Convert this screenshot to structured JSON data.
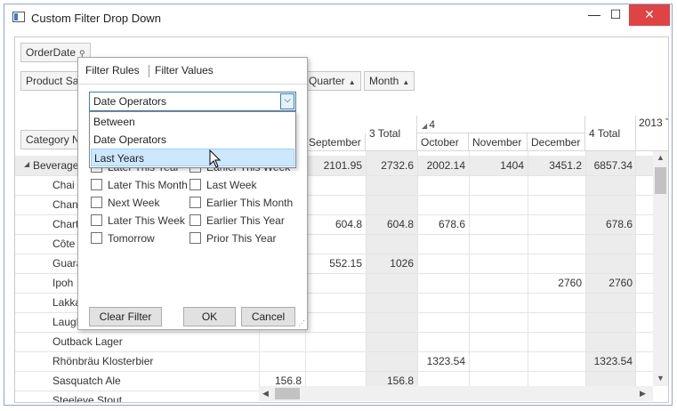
{
  "window": {
    "title": "Custom Filter Drop Down",
    "minimize": "—",
    "maximize": "☐",
    "close": "✕"
  },
  "fields": {
    "filter_area": "OrderDate",
    "row_field_1": "Product Sa",
    "row_field_2": "Category N",
    "column_fields": [
      "Quarter",
      "Month"
    ]
  },
  "column_headers": {
    "september": "September",
    "q3_total": "3 Total",
    "q4": "4",
    "october": "October",
    "november": "November",
    "december": "December",
    "q4_total": "4 Total",
    "year_2013": "2013 T"
  },
  "rows": [
    {
      "label": "Beverage",
      "vals": [
        "2101.95",
        "2732.6",
        "2002.14",
        "1404",
        "3451.2",
        "6857.34"
      ]
    },
    {
      "label": "Chai",
      "vals": [
        "",
        "",
        "",
        "",
        "",
        ""
      ]
    },
    {
      "label": "Chan",
      "vals": [
        "",
        "",
        "",
        "",
        "",
        ""
      ]
    },
    {
      "label": "Chart",
      "vals": [
        "604.8",
        "604.8",
        "678.6",
        "",
        "",
        "678.6"
      ]
    },
    {
      "label": "Côte",
      "vals": [
        "",
        "",
        "",
        "",
        "",
        ""
      ]
    },
    {
      "label": "Guara",
      "vals": [
        "552.15",
        "1026",
        "",
        "",
        "",
        ""
      ]
    },
    {
      "label": "Ipoh",
      "vals": [
        "",
        "",
        "",
        "",
        "2760",
        "2760"
      ]
    },
    {
      "label": "Lakka",
      "vals": [
        "",
        "",
        "",
        "",
        "",
        ""
      ]
    },
    {
      "label": "Laugh",
      "vals": [
        "",
        "",
        "",
        "",
        "",
        ""
      ]
    },
    {
      "label": "Outback Lager",
      "vals": [
        "",
        "",
        "",
        "",
        "",
        ""
      ]
    },
    {
      "label": "Rhönbräu Klosterbier",
      "vals": [
        "",
        "",
        "1323.54",
        "",
        "",
        "1323.54"
      ]
    },
    {
      "label": "Sasquatch Ale",
      "vals": [
        "",
        "156.8",
        "",
        "",
        "",
        ""
      ],
      "extra": "156.8"
    },
    {
      "label": "Steeleye Stout",
      "vals": [
        "",
        "",
        "",
        "",
        "",
        ""
      ]
    }
  ],
  "popup": {
    "tab_rules": "Filter Rules",
    "tab_values": "Filter Values",
    "combo_value": "Date Operators",
    "options": [
      "Between",
      "Date Operators",
      "Last Years"
    ],
    "checks_left": [
      "Later This Year",
      "Later This Month",
      "Next Week",
      "Later This Week",
      "Tomorrow"
    ],
    "checks_right": [
      "Earlier This Week",
      "Last Week",
      "Earlier This Month",
      "Earlier This Year",
      "Prior This Year"
    ],
    "clear": "Clear Filter",
    "ok": "OK",
    "cancel": "Cancel"
  }
}
